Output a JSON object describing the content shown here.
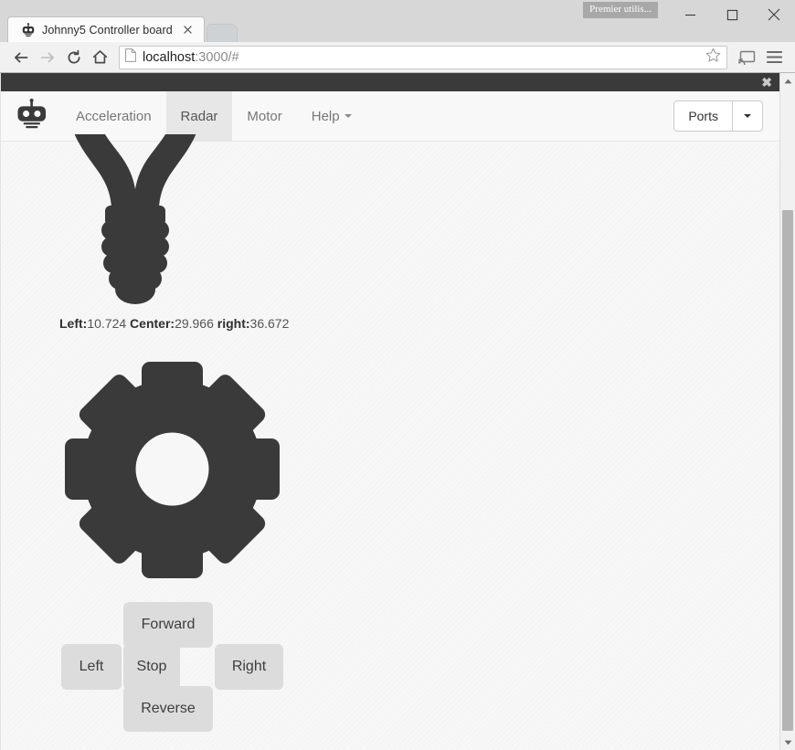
{
  "browser": {
    "tab": {
      "title": "Johnny5 Controller board",
      "favicon_icon": "robot-head-icon",
      "close_icon": "close-icon"
    },
    "new_tab_icon": "new-tab-icon",
    "window_controls": {
      "minimize_icon": "minimize-icon",
      "maximize_icon": "maximize-icon",
      "close_icon": "close-icon"
    },
    "user_chip_label": "Premier utilis...",
    "toolbar": {
      "back_icon": "back-arrow-icon",
      "forward_icon": "forward-arrow-icon",
      "reload_icon": "reload-icon",
      "home_icon": "home-icon",
      "page_icon": "document-icon",
      "url_host": "localhost",
      "url_rest": ":3000/#",
      "url_full": "localhost:3000/#",
      "bookmark_icon": "star-icon",
      "cast_icon": "cast-icon",
      "menu_icon": "hamburger-menu-icon"
    }
  },
  "notification_bar": {
    "close_icon": "close-icon"
  },
  "navbar": {
    "brand_icon": "robot-head-icon",
    "items": [
      {
        "label": "Acceleration",
        "active": false,
        "has_caret": false
      },
      {
        "label": "Radar",
        "active": true,
        "has_caret": false
      },
      {
        "label": "Motor",
        "active": false,
        "has_caret": false
      },
      {
        "label": "Help",
        "active": false,
        "has_caret": true
      }
    ],
    "ports_button": {
      "label": "Ports",
      "caret_icon": "chevron-down-icon"
    }
  },
  "content": {
    "bulb_icon": "lightbulb-icon",
    "gear_icon": "gear-icon",
    "sensor_readout": {
      "left_label": "Left:",
      "left_value": "10.724",
      "center_label": "Center:",
      "center_value": "29.966",
      "right_label": "right:",
      "right_value": "36.672"
    },
    "dpad": {
      "forward": "Forward",
      "left": "Left",
      "stop": "Stop",
      "right": "Right",
      "reverse": "Reverse"
    }
  },
  "scrollbar": {
    "up_arrow_icon": "scroll-up-icon",
    "down_arrow_icon": "scroll-down-icon"
  },
  "colors": {
    "navbar_bg": "#f8f8f8",
    "nav_active_bg": "#e7e7e7",
    "notif_bar_bg": "#3a3a3a",
    "icon_dark": "#333333",
    "button_bg": "#dcdcdc",
    "page_bg": "#f7f7f7"
  }
}
